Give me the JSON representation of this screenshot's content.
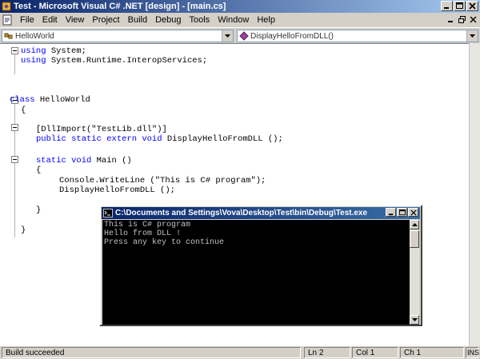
{
  "window": {
    "title": "Test - Microsoft Visual C# .NET [design] - [main.cs]"
  },
  "menu": {
    "items": [
      "File",
      "Edit",
      "View",
      "Project",
      "Build",
      "Debug",
      "Tools",
      "Window",
      "Help"
    ]
  },
  "navbar": {
    "class_combo": "HelloWorld",
    "member_combo": "DisplayHelloFromDLL()"
  },
  "editor": {
    "lines": [
      {
        "kw": "using",
        "rest": " System;"
      },
      {
        "kw": "using",
        "rest": " System.Runtime.InteropServices;"
      },
      {
        "kw": "class",
        "rest": " HelloWorld"
      },
      {
        "kw": "",
        "rest": "{"
      },
      {
        "kw": "",
        "rest": "[DllImport(\"TestLib.dll\")]"
      },
      {
        "kw": "public static extern void",
        "rest": " DisplayHelloFromDLL ();"
      },
      {
        "kw": "static void",
        "rest": " Main ()"
      },
      {
        "kw": "",
        "rest": "{"
      },
      {
        "kw": "",
        "rest": "Console.WriteLine (\"This is C# program\");"
      },
      {
        "kw": "",
        "rest": "DisplayHelloFromDLL ();"
      },
      {
        "kw": "",
        "rest": "}"
      },
      {
        "kw": "",
        "rest": "}"
      }
    ]
  },
  "console": {
    "title": "C:\\Documents and Settings\\Vova\\Desktop\\Test\\bin\\Debug\\Test.exe",
    "output": "This is C# program\nHello from DLL !\nPress any key to continue"
  },
  "status": {
    "message": "Build succeeded",
    "line": "Ln 2",
    "col": "Col 1",
    "ch": "Ch 1",
    "mode": "INS"
  },
  "colors": {
    "keyword": "#0000ff",
    "titlebar_start": "#0a246a",
    "titlebar_end": "#a6caf0",
    "console_bg": "#000000",
    "console_fg": "#c0c0c0"
  }
}
